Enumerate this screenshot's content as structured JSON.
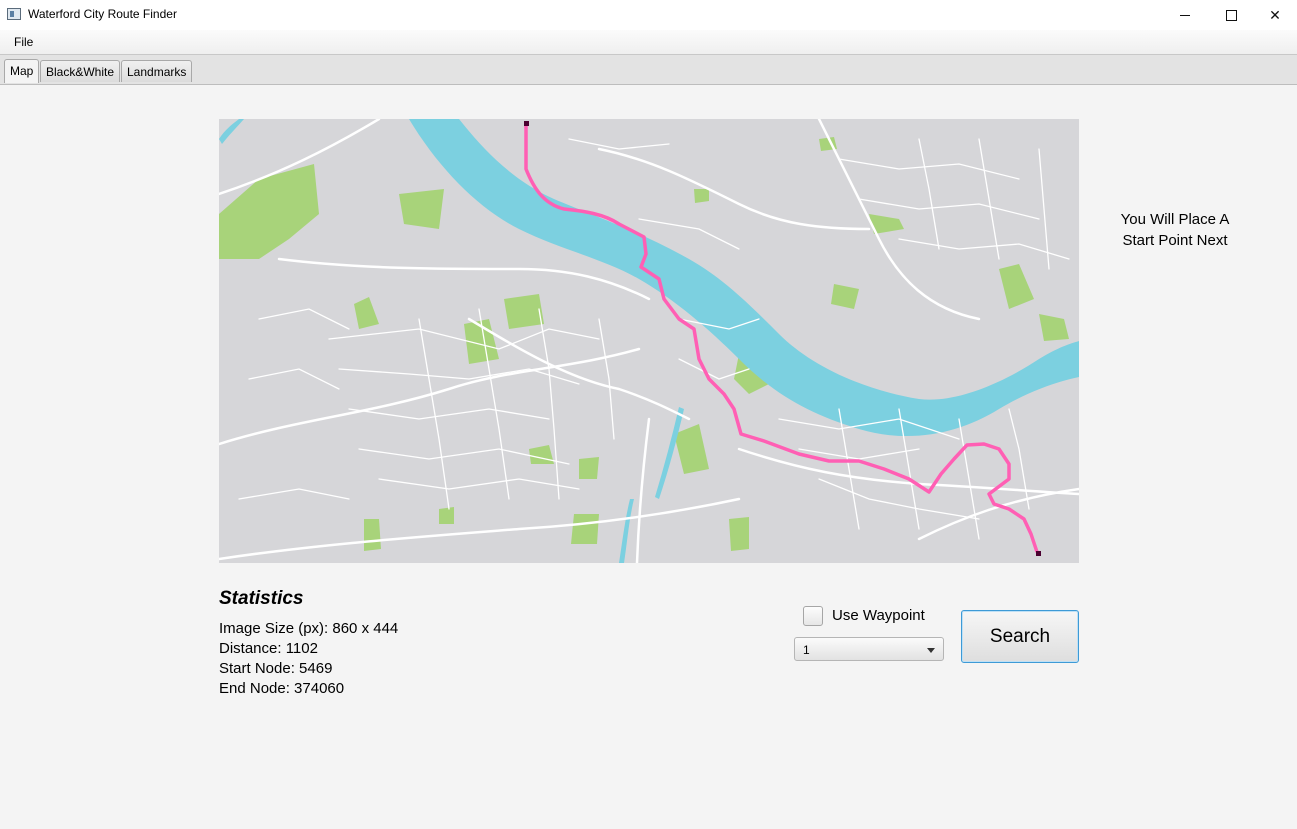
{
  "window": {
    "title": "Waterford City Route Finder"
  },
  "menu": {
    "file": "File"
  },
  "tabs": [
    {
      "label": "Map",
      "active": true
    },
    {
      "label": "Black&White",
      "active": false
    },
    {
      "label": "Landmarks",
      "active": false
    }
  ],
  "side_info": {
    "line1": "You Will Place A",
    "line2": "Start Point Next"
  },
  "statistics": {
    "title": "Statistics",
    "image_size": "Image Size (px): 860 x 444",
    "distance": "Distance: 1102",
    "start_node": "Start Node: 5469",
    "end_node": "End Node: 374060"
  },
  "controls": {
    "use_waypoint_label": "Use Waypoint",
    "use_waypoint_checked": false,
    "waypoint_select_value": "1",
    "search_label": "Search"
  },
  "colors": {
    "land": "#d6d6d9",
    "road": "#ffffff",
    "river": "#7cd0e0",
    "park": "#a8d37a",
    "route": "#ff5fb4",
    "accent": "#3d9ad6"
  }
}
